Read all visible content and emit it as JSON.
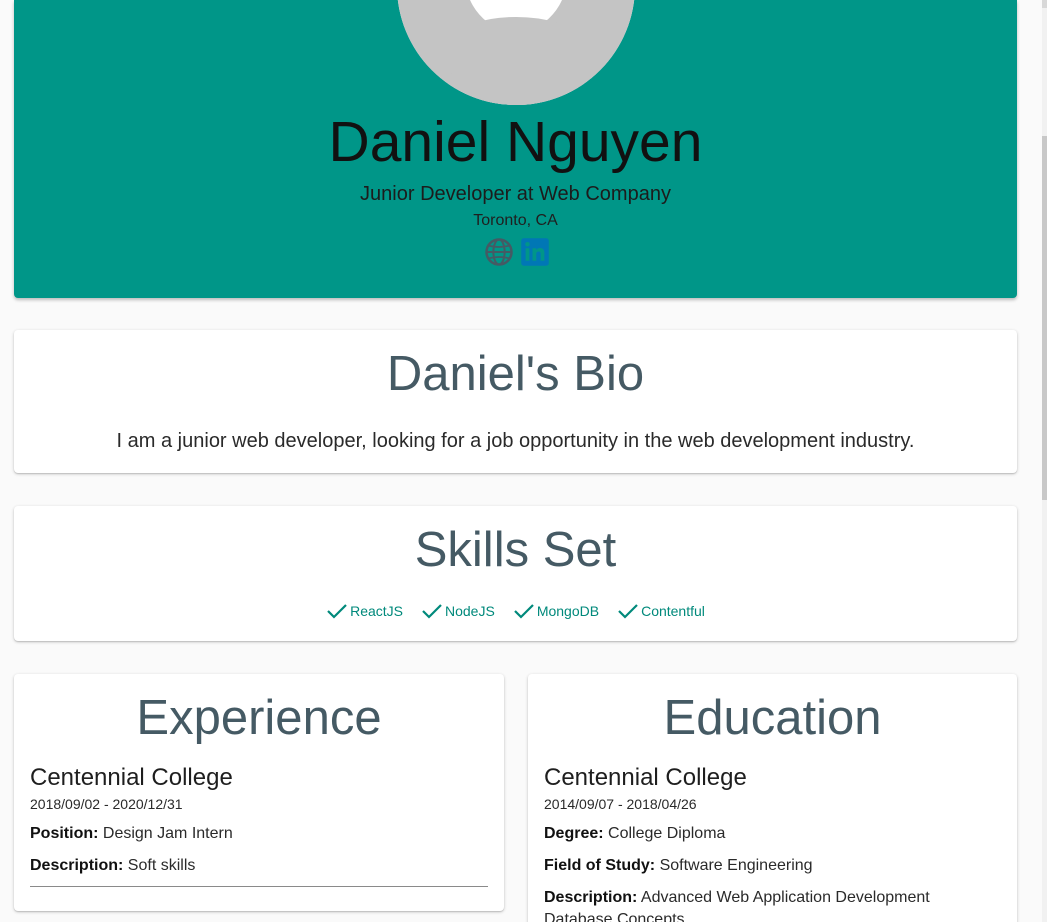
{
  "profile": {
    "name": "Daniel Nguyen",
    "headline": "Junior Developer at Web Company",
    "location": "Toronto, CA",
    "social": [
      {
        "icon": "globe-icon",
        "color": "#455a64"
      },
      {
        "icon": "linkedin-icon",
        "color": "#0077b5"
      }
    ]
  },
  "bio": {
    "title": "Daniel's Bio",
    "text": "I am a junior web developer, looking for a job opportunity in the web development industry."
  },
  "skills": {
    "title": "Skills Set",
    "items": [
      "ReactJS",
      "NodeJS",
      "MongoDB",
      "Contentful"
    ]
  },
  "experience": {
    "title": "Experience",
    "items": [
      {
        "organization": "Centennial College",
        "dates": "2018/09/02 - 2020/12/31",
        "position_label": "Position:",
        "position": "Design Jam Intern",
        "description_label": "Description:",
        "description": "Soft skills"
      }
    ]
  },
  "education": {
    "title": "Education",
    "items": [
      {
        "organization": "Centennial College",
        "dates": "2014/09/07 - 2018/04/26",
        "degree_label": "Degree:",
        "degree": "College Diploma",
        "field_label": "Field of Study:",
        "field": "Software Engineering",
        "description_label": "Description:",
        "description": "Advanced Web Application Development",
        "description_more": "Database Concepts"
      }
    ]
  },
  "colors": {
    "header_bg": "#009688",
    "card_title": "#455a64",
    "skill_accent": "#00897b"
  }
}
